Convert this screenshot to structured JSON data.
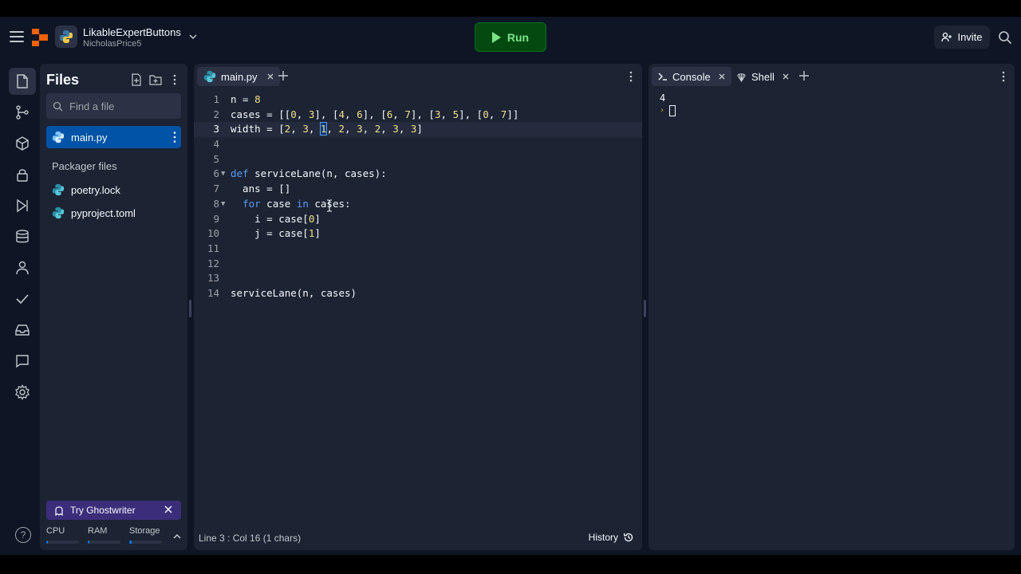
{
  "header": {
    "repl_name": "LikableExpertButtons",
    "owner": "NicholasPrice5",
    "run_label": "Run",
    "invite_label": "Invite",
    "run_color": "#7ce38b"
  },
  "files_panel": {
    "title": "Files",
    "search_placeholder": "Find a file",
    "files": [
      {
        "name": "main.py",
        "active": true
      }
    ],
    "section_label": "Packager files",
    "packager_files": [
      {
        "name": "poetry.lock"
      },
      {
        "name": "pyproject.toml"
      }
    ],
    "ghostwriter_label": "Try Ghostwriter",
    "resources": [
      {
        "label": "CPU",
        "level": 0.05
      },
      {
        "label": "RAM",
        "level": 0.05
      },
      {
        "label": "Storage",
        "level": 0.08
      }
    ],
    "help_label": "?"
  },
  "editor": {
    "tab_label": "main.py",
    "current_line": 3,
    "lines": [
      {
        "num": "1",
        "fold": ""
      },
      {
        "num": "2",
        "fold": ""
      },
      {
        "num": "3",
        "fold": ""
      },
      {
        "num": "4",
        "fold": ""
      },
      {
        "num": "5",
        "fold": ""
      },
      {
        "num": "6",
        "fold": "▼"
      },
      {
        "num": "7",
        "fold": ""
      },
      {
        "num": "8",
        "fold": "▼"
      },
      {
        "num": "9",
        "fold": ""
      },
      {
        "num": "10",
        "fold": ""
      },
      {
        "num": "11",
        "fold": ""
      },
      {
        "num": "12",
        "fold": ""
      },
      {
        "num": "13",
        "fold": ""
      },
      {
        "num": "14",
        "fold": ""
      }
    ],
    "code": [
      "n = 8",
      "cases = [[0, 3], [4, 6], [6, 7], [3, 5], [0, 7]]",
      "width = [2, 3, 1, 2, 3, 2, 3, 3]",
      "",
      "",
      "def serviceLane(n, cases):",
      "  ans = []",
      "  for case in cases:",
      "    i = case[0]",
      "    j = case[1]",
      "",
      "",
      "",
      "serviceLane(n, cases)"
    ],
    "status": "Line 3 : Col 16 (1 chars)",
    "history_label": "History"
  },
  "console": {
    "tabs": [
      {
        "label": "Console",
        "icon": "terminal-icon"
      },
      {
        "label": "Shell",
        "icon": "shell-icon"
      }
    ],
    "output": "4"
  },
  "icons": {
    "rail": [
      "files-icon",
      "git-icon",
      "packages-icon",
      "secrets-icon",
      "debugger-icon",
      "database-icon",
      "multiplayer-icon",
      "tests-icon",
      "inbox-icon",
      "threads-icon",
      "settings-icon"
    ]
  }
}
